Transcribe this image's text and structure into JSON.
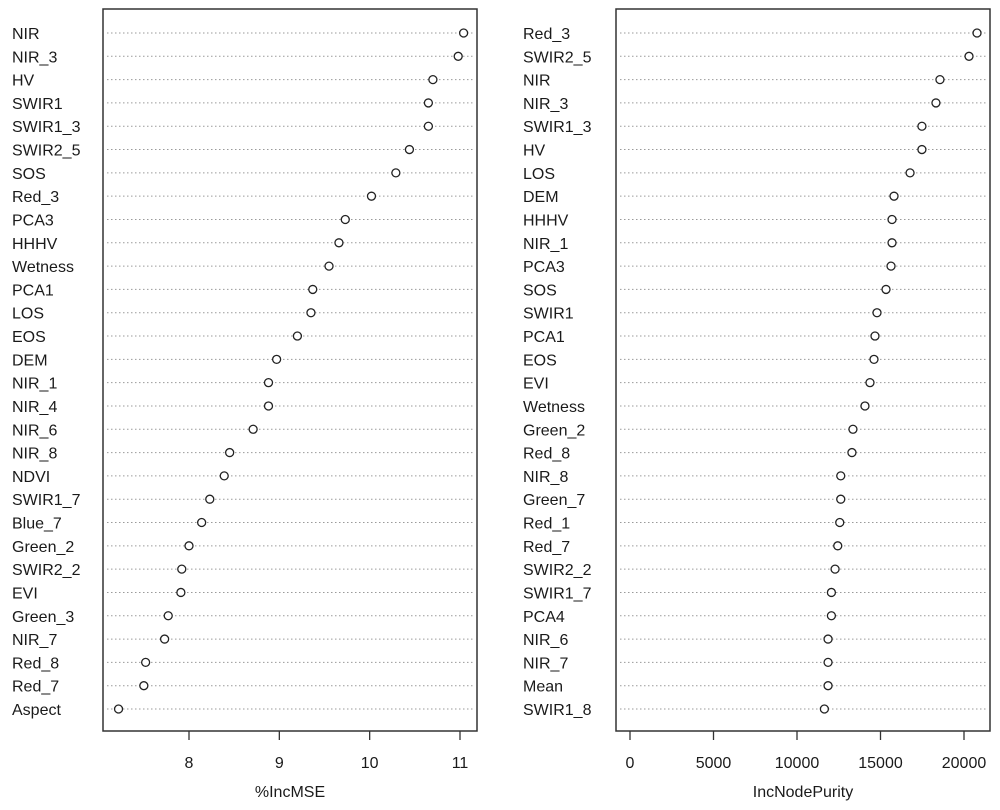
{
  "chart_data": [
    {
      "type": "scatter",
      "subtype": "dotchart",
      "title": "",
      "xlabel": "%IncMSE",
      "ylabel": "",
      "xlim": [
        7.05,
        11.2
      ],
      "xticks": [
        8,
        9,
        10,
        11
      ],
      "xtick_labels": [
        "8",
        "9",
        "10",
        "11"
      ],
      "grid": "horizontal dotted guides",
      "categories": [
        "NIR",
        "NIR_3",
        "HV",
        "SWIR1",
        "SWIR1_3",
        "SWIR2_5",
        "SOS",
        "Red_3",
        "PCA3",
        "HHHV",
        "Wetness",
        "PCA1",
        "LOS",
        "EOS",
        "DEM",
        "NIR_1",
        "NIR_4",
        "NIR_6",
        "NIR_8",
        "NDVI",
        "SWIR1_7",
        "Blue_7",
        "Green_2",
        "SWIR2_2",
        "EVI",
        "Green_3",
        "NIR_7",
        "Red_8",
        "Red_7",
        "Aspect"
      ],
      "values": [
        11.04,
        10.98,
        10.7,
        10.65,
        10.65,
        10.44,
        10.29,
        10.02,
        9.73,
        9.66,
        9.55,
        9.37,
        9.35,
        9.2,
        8.97,
        8.88,
        8.88,
        8.71,
        8.45,
        8.39,
        8.23,
        8.14,
        8.0,
        7.92,
        7.91,
        7.77,
        7.73,
        7.52,
        7.5,
        7.22
      ]
    },
    {
      "type": "scatter",
      "subtype": "dotchart",
      "title": "",
      "xlabel": "IncNodePurity",
      "ylabel": "",
      "xlim": [
        -800,
        21500
      ],
      "xticks": [
        0,
        5000,
        10000,
        15000,
        20000
      ],
      "xtick_labels": [
        "0",
        "5000",
        "10000",
        "15000",
        "20000"
      ],
      "grid": "horizontal dotted guides",
      "categories": [
        "Red_3",
        "SWIR2_5",
        "NIR",
        "NIR_3",
        "SWIR1_3",
        "HV",
        "LOS",
        "DEM",
        "HHHV",
        "NIR_1",
        "PCA3",
        "SOS",
        "SWIR1",
        "PCA1",
        "EOS",
        "EVI",
        "Wetness",
        "Green_2",
        "Red_8",
        "NIR_8",
        "Green_7",
        "Red_1",
        "Red_7",
        "SWIR2_2",
        "SWIR1_7",
        "PCA4",
        "NIR_6",
        "NIR_7",
        "Mean",
        "SWIR1_8"
      ],
      "values": [
        20780,
        20300,
        18560,
        18320,
        17480,
        17480,
        16770,
        15810,
        15690,
        15690,
        15630,
        15330,
        14790,
        14670,
        14610,
        14370,
        14070,
        13350,
        13290,
        12620,
        12620,
        12560,
        12440,
        12280,
        12060,
        12060,
        11860,
        11860,
        11860,
        11640
      ]
    }
  ]
}
